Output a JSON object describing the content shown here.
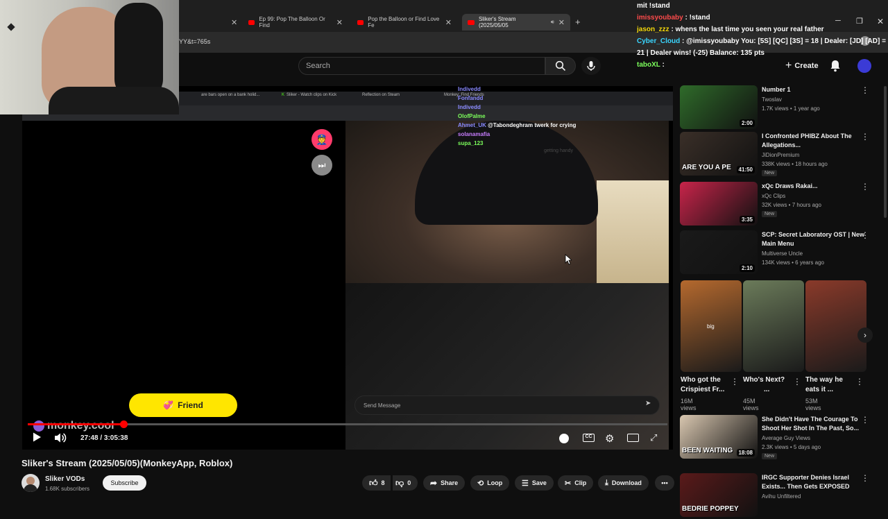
{
  "browser": {
    "tabs": [
      {
        "label": "Ep 99: Pop The Balloon Or Find",
        "active": false
      },
      {
        "label": "Pop the Balloon or Find Love Fe",
        "active": false
      },
      {
        "label": "Sliker's Stream (2025/05/05",
        "active": true
      }
    ],
    "url_fragment": "YY&t=765s",
    "new_tab": "+"
  },
  "header": {
    "search_placeholder": "Search",
    "create_label": "Create"
  },
  "stream_chat": [
    {
      "user": "mit",
      "color": "#ffffff",
      "text": "!stand"
    },
    {
      "user": "imissyoubaby",
      "color": "#ff4b4b",
      "text": ": !stand"
    },
    {
      "user": "jason_zzz",
      "color": "#f5d90a",
      "text": ": whens the last time you seen your real father"
    },
    {
      "user": "Cyber_Cloud",
      "color": "#3ad6ff",
      "text": ": @imissyoubaby You: [5S] [QC] [3S] = 18 | Dealer: [JD] [AD] ="
    },
    {
      "user": "",
      "color": "#ffffff",
      "text": "21 | Dealer wins! (-25) Balance: 135 pts"
    },
    {
      "user": "taboXL",
      "color": "#7cff5c",
      "text": ":"
    }
  ],
  "inner_browser": {
    "tabs": [
      "are bars open on a bank holid...",
      "Sliker - Watch clips on Kick",
      "Reflection on Steam",
      "Monkey: Find Friends"
    ],
    "chat": [
      {
        "user": "Indivedd",
        "color": "#8a8aff",
        "text": ""
      },
      {
        "user": "Fonfandd",
        "color": "#8a8aff",
        "text": ""
      },
      {
        "user": "Indivedd",
        "color": "#8a8aff",
        "text": ""
      },
      {
        "user": "OlofPalme",
        "color": "#7cff5c",
        "text": ""
      },
      {
        "user": "Ahmet_UK",
        "color": "#8a8aff",
        "text": "@Tabondeghram twerk for crying"
      },
      {
        "user": "solanamafia",
        "color": "#c77dff",
        "text": ""
      },
      {
        "user": "supa_123",
        "color": "#7cff5c",
        "text": ""
      }
    ],
    "faint_caption": "getting handy"
  },
  "monkey": {
    "friend_label": "Friend",
    "send_placeholder": "Send Message",
    "logo_text": "monkey.cool"
  },
  "player": {
    "timecode": "27:48 / 3:05:38",
    "progress": 0.15
  },
  "video": {
    "title": "Sliker's Stream (2025/05/05)(MonkeyApp, Roblox)",
    "channel": "Sliker VODs",
    "subscribers": "1.68K subscribers",
    "subscribe_label": "Subscribe",
    "likes": "8",
    "dislikes": "0",
    "share_label": "Share",
    "loop_label": "Loop",
    "save_label": "Save",
    "clip_label": "Clip",
    "download_label": "Download"
  },
  "recommendations": [
    {
      "title": "Number 1",
      "channel": "Twoslav",
      "meta": "1.7K views • 1 year ago",
      "duration": "2:00",
      "new": "",
      "thumb": "#2f6b2a"
    },
    {
      "title": "I Confronted PHIBZ About The Allegations...",
      "channel": "JiDionPremium",
      "meta": "338K views • 18 hours ago",
      "duration": "41:50",
      "new": "New",
      "thumb": "#3a2f28",
      "thumb_text": "ARE YOU A PE"
    },
    {
      "title": "xQc Draws Rakai...",
      "channel": "xQc Clips",
      "meta": "32K views • 7 hours ago",
      "duration": "3:35",
      "new": "New",
      "thumb": "#c8244a"
    },
    {
      "title": "SCP: Secret Laboratory OST | New Main Menu",
      "channel": "Multiverse Uncle",
      "meta": "134K views • 6 years ago",
      "duration": "2:10",
      "new": "",
      "thumb": "#1a1a1a"
    }
  ],
  "shorts": [
    {
      "title": "Who got the Crispiest Fr...",
      "views": "16M views",
      "thumb": "#b5692e",
      "tag": "big"
    },
    {
      "title": "Who's Next?",
      "subtitle": "...",
      "views": "45M views",
      "thumb": "#6b7b5a"
    },
    {
      "title": "The way he eats it ...",
      "views": "53M views",
      "thumb": "#8a3a2a"
    }
  ],
  "recommendations2": [
    {
      "title": "She Didn't Have The Courage To Shoot Her Shot In The Past, So...",
      "channel": "Average Guy Views",
      "meta": "2.3K views • 5 days ago",
      "duration": "18:08",
      "new": "New",
      "thumb": "#d9c7b0",
      "thumb_text": "BEEN WAITING"
    },
    {
      "title": "IRGC Supporter Denies Israel Exists... Then Gets EXPOSED",
      "channel": "Avihu Unfiltered",
      "meta": "",
      "duration": "",
      "new": "",
      "thumb": "#5a1a1a",
      "thumb_text": "BEDRIE POPPEY"
    }
  ]
}
